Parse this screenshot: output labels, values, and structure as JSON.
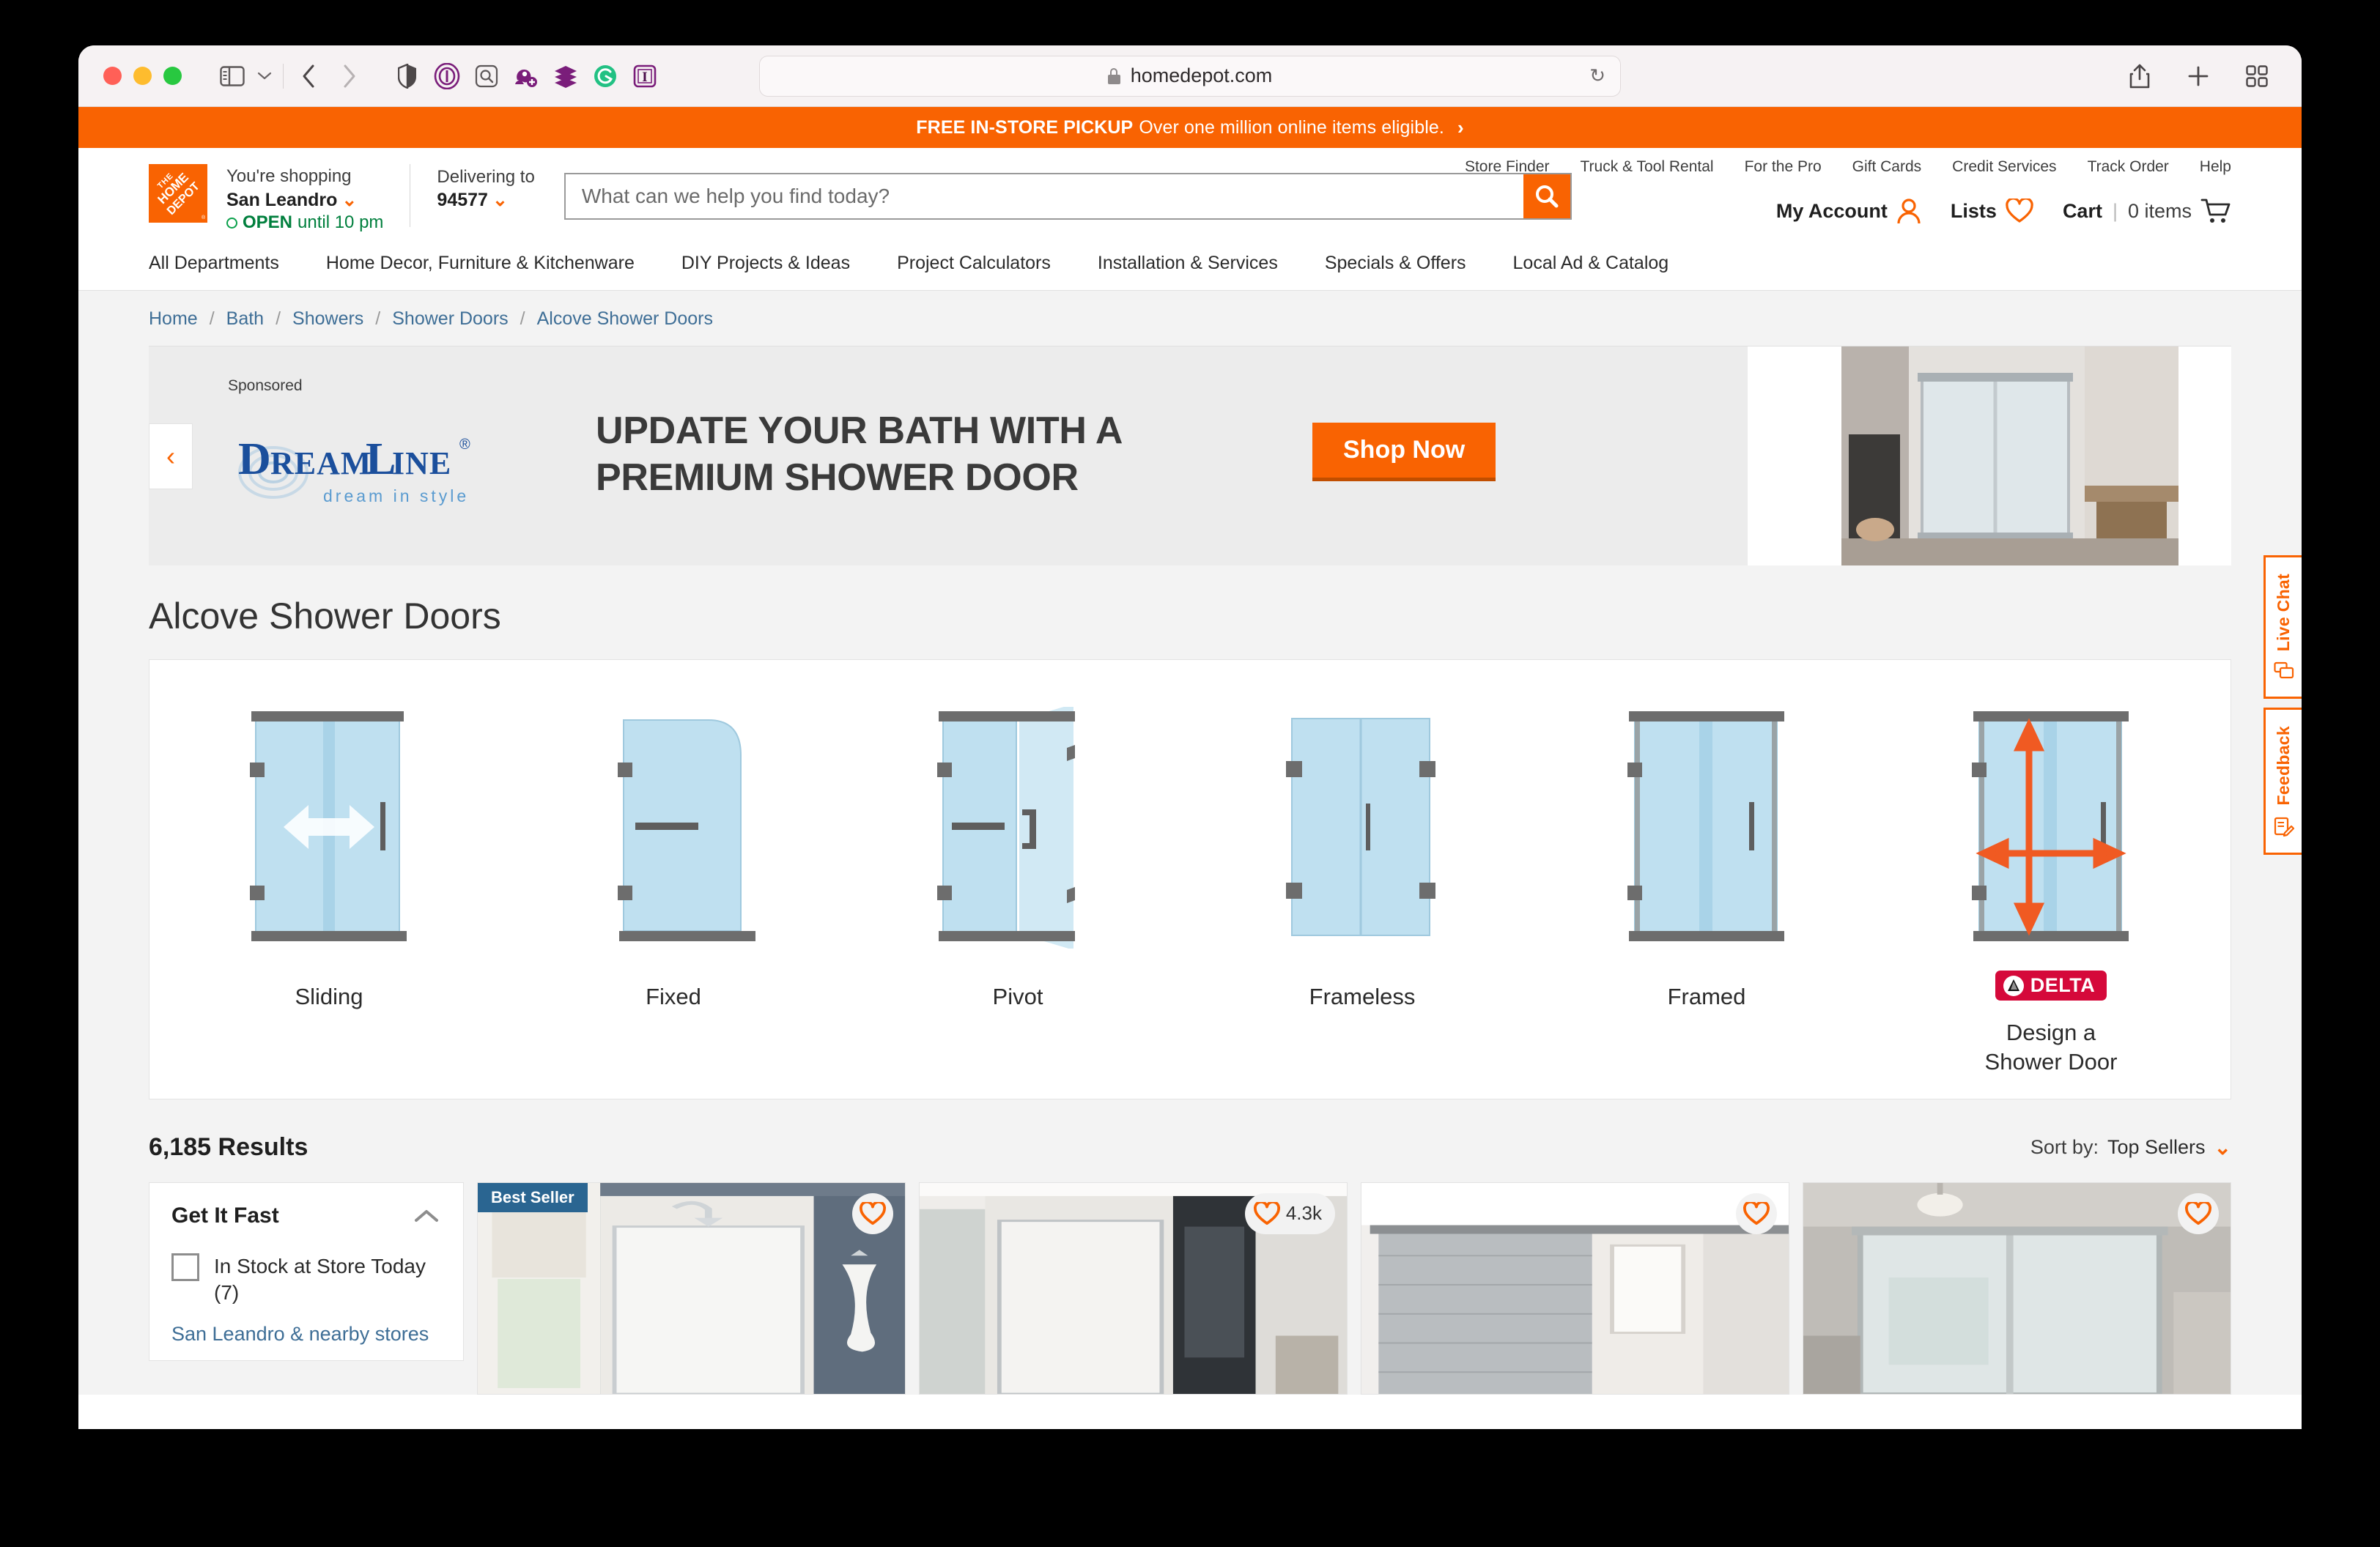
{
  "browser": {
    "url": "homedepot.com",
    "toolbar_icons": [
      "sidebar-icon",
      "chevron-down-icon",
      "back-icon",
      "forward-icon",
      "shield-icon",
      "privacy-badger-icon",
      "search-extension-icon",
      "honey-icon",
      "buffer-icon",
      "grammarly-icon",
      "italic-extension-icon"
    ],
    "right_icons": [
      "share-icon",
      "new-tab-icon",
      "tab-overview-icon"
    ],
    "reload_label": "↻"
  },
  "promo": {
    "bold": "FREE IN-STORE PICKUP",
    "text": "Over one million online items eligible.",
    "chevron": "›"
  },
  "header": {
    "store": {
      "line1": "You're shopping",
      "city": "San Leandro",
      "open_bold": "OPEN",
      "open_rest": "until 10 pm",
      "carat": "⌄"
    },
    "delivering": {
      "label": "Delivering to",
      "zip": "94577",
      "carat": "⌄"
    },
    "search": {
      "placeholder": "What can we help you find today?",
      "value": ""
    },
    "account": {
      "my_account": "My Account",
      "lists": "Lists",
      "cart": "Cart",
      "cart_sep": "|",
      "cart_items": "0 items"
    },
    "utility_links": [
      "Store Finder",
      "Truck & Tool Rental",
      "For the Pro",
      "Gift Cards",
      "Credit Services",
      "Track Order",
      "Help"
    ],
    "main_nav": [
      "All Departments",
      "Home Decor, Furniture & Kitchenware",
      "DIY Projects & Ideas",
      "Project Calculators",
      "Installation & Services",
      "Specials & Offers",
      "Local Ad & Catalog"
    ]
  },
  "breadcrumb": {
    "items": [
      "Home",
      "Bath",
      "Showers",
      "Shower Doors",
      "Alcove Shower Doors"
    ],
    "separator": "/"
  },
  "ad": {
    "sponsored_label": "Sponsored",
    "brand": "DreamLine",
    "brand_tagline": "dream in style",
    "brand_reg": "®",
    "headline_line1": "UPDATE YOUR BATH WITH A",
    "headline_line2": "PREMIUM SHOWER DOOR",
    "cta": "Shop Now",
    "prev_arrow": "‹"
  },
  "page_title": "Alcove Shower Doors",
  "category_tiles": [
    {
      "label": "Sliding",
      "type": "sliding"
    },
    {
      "label": "Fixed",
      "type": "fixed"
    },
    {
      "label": "Pivot",
      "type": "pivot"
    },
    {
      "label": "Frameless",
      "type": "frameless"
    },
    {
      "label": "Framed",
      "type": "framed"
    },
    {
      "label": "Design a\nShower Door",
      "label_line1": "Design a",
      "label_line2": "Shower Door",
      "type": "delta",
      "brand": "DELTA"
    }
  ],
  "results": {
    "count_label": "6,185 Results",
    "sort_label": "Sort by:",
    "sort_value": "Top Sellers",
    "sort_carat": "⌄"
  },
  "filters": {
    "panel_title": "Get It Fast",
    "collapse_icon": "chevron-up-icon",
    "options": [
      {
        "label": "In Stock at Store Today (7)",
        "checked": false
      }
    ],
    "store_link": "San Leandro & nearby stores"
  },
  "products": [
    {
      "badge": "Best Seller",
      "fav_count": null
    },
    {
      "badge": null,
      "fav_count": "4.3k"
    },
    {
      "badge": null,
      "fav_count": null
    },
    {
      "badge": null,
      "fav_count": null
    }
  ],
  "side_tabs": [
    {
      "label": "Live Chat",
      "icon": "chat-bubbles-icon"
    },
    {
      "label": "Feedback",
      "icon": "clipboard-pencil-icon"
    }
  ],
  "colors": {
    "brand_orange": "#f96302",
    "link_blue": "#3e6e96",
    "open_green": "#007f3d",
    "badge_blue": "#2a6591",
    "delta_red": "#d5093a",
    "glass_blue": "#bfe0f0",
    "frame_gray": "#6d6d6d"
  }
}
